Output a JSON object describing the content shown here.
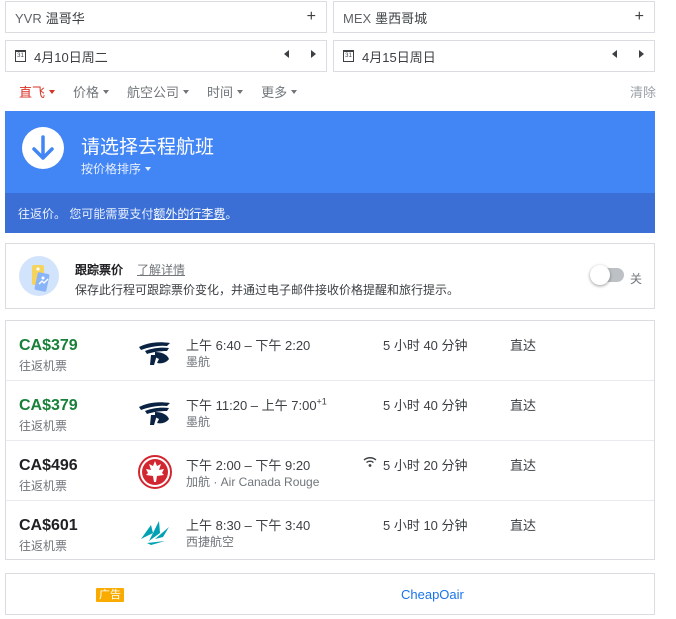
{
  "search": {
    "origin_code": "YVR",
    "origin_city": "温哥华",
    "destination_code": "MEX",
    "destination_city": "墨西哥城",
    "add_symbol": "+",
    "depart_date": "4月10日周二",
    "return_date": "4月15日周日",
    "calendar_day": "31"
  },
  "filters": {
    "items": [
      "直飞",
      "价格",
      "航空公司",
      "时间",
      "更多"
    ],
    "clear_label": "清除",
    "active_color": "#d93025"
  },
  "banner": {
    "title": "请选择去程航班",
    "sort_label": "按价格排序",
    "note_prefix": "往返价。 您可能需要支付",
    "note_link": "额外的行李费",
    "note_suffix": "。",
    "color": "#4285f4"
  },
  "tracker": {
    "title": "跟踪票价",
    "details_link": "了解详情",
    "description": "保存此行程可跟踪票价变化，并通过电子邮件接收价格提醒和旅行提示。",
    "toggle_label": "关",
    "toggle_on": false
  },
  "flights": [
    {
      "price": "CA$379",
      "price_note": "往返机票",
      "cheapest": true,
      "logo": "aeromexico-logo",
      "times": "上午 6:40 – 下午 2:20",
      "times_suffix": "",
      "carrier": "墨航",
      "duration": "5 小时 40 分钟",
      "stops": "直达",
      "wifi": false
    },
    {
      "price": "CA$379",
      "price_note": "往返机票",
      "cheapest": true,
      "logo": "aeromexico-logo",
      "times": "下午 11:20 – 上午 7:00",
      "times_suffix": "+1",
      "carrier": "墨航",
      "duration": "5 小时 40 分钟",
      "stops": "直达",
      "wifi": false
    },
    {
      "price": "CA$496",
      "price_note": "往返机票",
      "cheapest": false,
      "logo": "air-canada-logo",
      "times": "下午 2:00 – 下午 9:20",
      "times_suffix": "",
      "carrier": "加航 · Air Canada Rouge",
      "duration": "5 小时 20 分钟",
      "stops": "直达",
      "wifi": true
    },
    {
      "price": "CA$601",
      "price_note": "往返机票",
      "cheapest": false,
      "logo": "westjet-logo",
      "times": "上午 8:30 – 下午 3:40",
      "times_suffix": "",
      "carrier": "西捷航空",
      "duration": "5 小时 10 分钟",
      "stops": "直达",
      "wifi": false
    }
  ],
  "ad": {
    "badge": "广告",
    "advertiser": "CheapOair"
  },
  "colors": {
    "price_green": "#188038",
    "link_blue": "#1a73e8",
    "ad_badge": "#f9ab00"
  }
}
